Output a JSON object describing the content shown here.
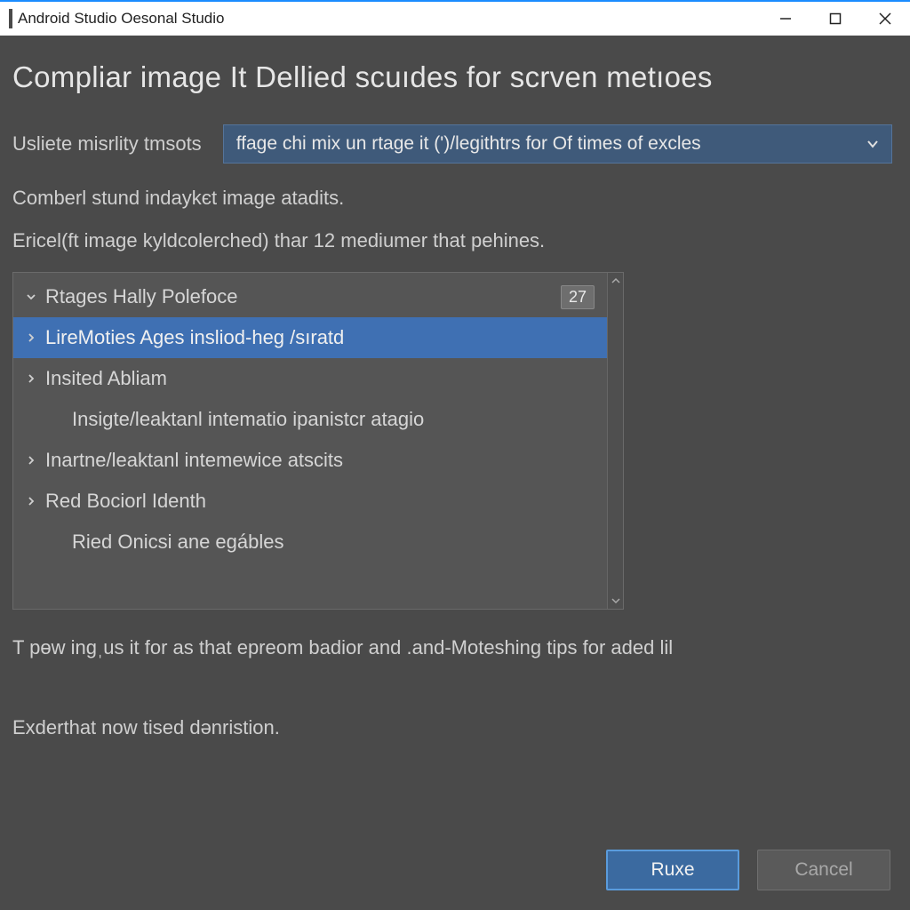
{
  "titlebar": {
    "title": "Android Studio Oesonal Studio"
  },
  "dialog": {
    "heading": "Compliar image It Dellied scuıdes for scrven metıoes",
    "dropdown_label": "Usliete misrlity tmsots",
    "dropdown_value": "ffage chi mix un rtage it (')/legithtrs for Of times of excles",
    "description1": "Comberl stund indaykєt image atadits.",
    "description2": "Ericel(ft image kyldcolerched) thar 12 mediumer that pehines.",
    "hint1": "T pɵw ingˌus it for as that epreom badior and .and-Moteshing tips for aded lil",
    "hint2": "Exderthat now tised dənristion."
  },
  "tree": {
    "items": [
      {
        "label": "Rtages Hally Polefoce",
        "badge": "27",
        "expanded": true,
        "has_children": true,
        "indent": false,
        "selected": false
      },
      {
        "label": "LireMoties Ages insliod-heɡ /sıratd",
        "expanded": false,
        "has_children": true,
        "indent": false,
        "selected": true
      },
      {
        "label": "Insited Abliam",
        "expanded": false,
        "has_children": true,
        "indent": false,
        "selected": false
      },
      {
        "label": "Insigte/leaktanl intematio ipanistcr atagio",
        "has_children": false,
        "indent": true,
        "selected": false
      },
      {
        "label": "Inartne/leaktanl intemewice atscits",
        "expanded": false,
        "has_children": true,
        "indent": false,
        "selected": false
      },
      {
        "label": "Red Bociorl Identh",
        "expanded": false,
        "has_children": true,
        "indent": false,
        "selected": false
      },
      {
        "label": "Ried Onicsi ane egábles",
        "has_children": false,
        "indent": true,
        "selected": false
      }
    ]
  },
  "buttons": {
    "primary": "Ruxe",
    "secondary": "Cancel"
  }
}
